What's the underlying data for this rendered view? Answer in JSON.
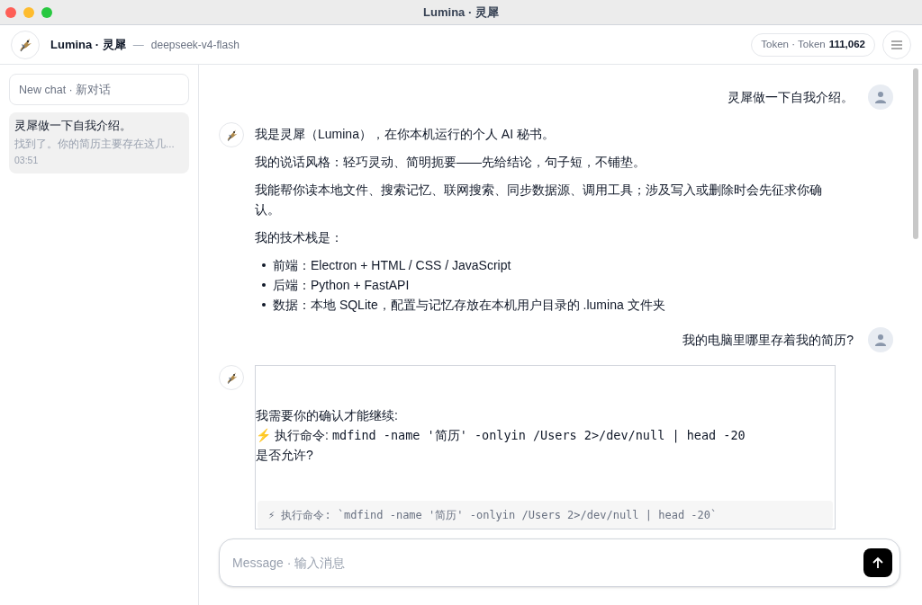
{
  "window": {
    "title": "Lumina · 灵犀"
  },
  "header": {
    "app_name": "Lumina · 灵犀",
    "separator": "—",
    "model": "deepseek-v4-flash",
    "token_label": "Token · Token",
    "token_count": "111,062"
  },
  "sidebar": {
    "new_chat_placeholder": "New chat · 新对话",
    "conversations": [
      {
        "title": "灵犀做一下自我介绍。",
        "preview": "找到了。你的简历主要存在这几...",
        "time": "03:51",
        "selected": true
      }
    ]
  },
  "messages": [
    {
      "kind": "user",
      "text": "灵犀做一下自我介绍。"
    },
    {
      "kind": "assistant",
      "paragraphs": [
        "我是灵犀（Lumina），在你本机运行的个人 AI 秘书。",
        "我的说话风格：轻巧灵动、简明扼要——先给结论，句子短，不铺垫。",
        "我能帮你读本地文件、搜索记忆、联网搜索、同步数据源、调用工具；涉及写入或删除时会先征求你确认。",
        "我的技术栈是："
      ],
      "bullets": [
        "前端：Electron + HTML / CSS / JavaScript",
        "后端：Python + FastAPI",
        "数据：本地 SQLite，配置与记忆存放在本机用户目录的 .lumina 文件夹"
      ]
    },
    {
      "kind": "user",
      "text": "我的电脑里哪里存着我的简历?"
    },
    {
      "kind": "permission",
      "intro": "我需要你的确认才能继续:",
      "bolt": "⚡",
      "command_label": "执行命令:",
      "command": "mdfind -name '简历' -onlyin /Users 2>/dev/null | head -20",
      "question": "是否允许?",
      "code_line": "⚡ 执行命令: `mdfind -name '简历' -onlyin /Users 2>/dev/null | head -20`"
    }
  ],
  "composer": {
    "placeholder": "Message · 输入消息"
  }
}
